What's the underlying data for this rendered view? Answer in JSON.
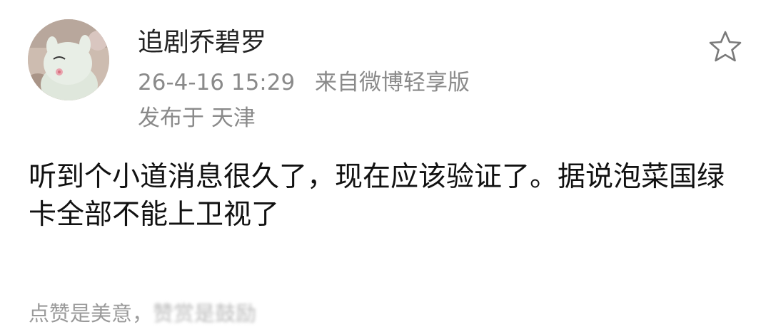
{
  "post": {
    "username": "追剧乔碧罗",
    "timestamp": "26-4-16 15:29",
    "source": "来自微博轻享版",
    "location": "发布于 天津",
    "content": "听到个小道消息很久了，现在应该验证了。据说泡菜国绿卡全部不能上卫视了",
    "footer_text": "点赞是美意，",
    "footer_blurred_text": "赞赏是鼓励"
  },
  "icons": {
    "favorite": "star-outline-icon",
    "avatar": "avatar-image"
  },
  "colors": {
    "username": "#222222",
    "meta": "#8a8a8a",
    "content": "#111111",
    "footer": "#9a9a9a"
  }
}
